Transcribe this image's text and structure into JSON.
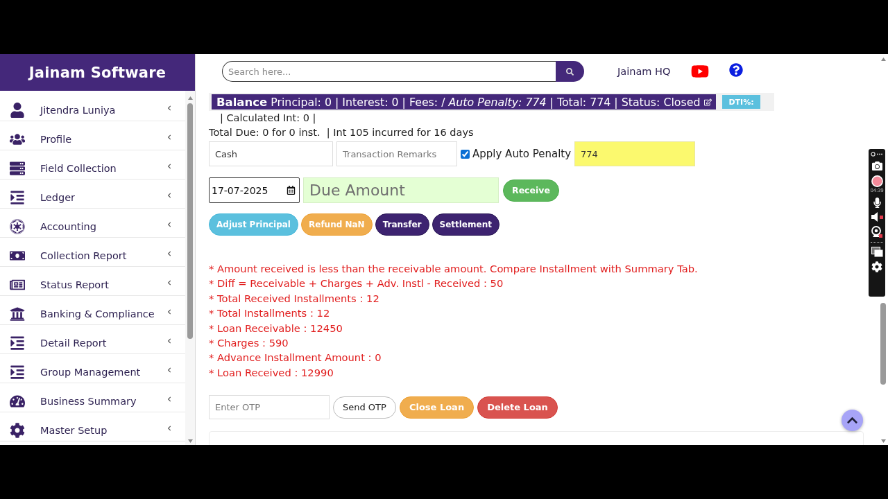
{
  "sidebar": {
    "title": "Jainam Software",
    "items": [
      {
        "label": "Jitendra Luniya"
      },
      {
        "label": "Profile"
      },
      {
        "label": "Field Collection"
      },
      {
        "label": "Ledger"
      },
      {
        "label": "Accounting"
      },
      {
        "label": "Collection Report"
      },
      {
        "label": "Status Report"
      },
      {
        "label": "Banking & Compliance"
      },
      {
        "label": "Detail Report"
      },
      {
        "label": "Group Management"
      },
      {
        "label": "Business Summary"
      },
      {
        "label": "Master Setup"
      }
    ]
  },
  "header": {
    "search": {
      "placeholder": "Search here..."
    },
    "branch": "Jainam HQ"
  },
  "balance": {
    "summary": "**Balance** Principal: 0 | Interest: 0 | Fees: / *Auto Penalty: 774* | Total: 774 | Status: Closed",
    "badge": "DTI%:",
    "calculated": "| Calculated Int: 0 |",
    "total_due": "Total Due: 0 for 0 inst.  | Int 105 incurred for 16 days"
  },
  "payment_form": {
    "mode": {
      "value": "Cash"
    },
    "remarks": {
      "placeholder": "Transaction Remarks"
    },
    "auto_penalty": {
      "label": "Apply Auto Penalty",
      "checked": true
    },
    "penalty_amount": {
      "value": "774"
    },
    "date": {
      "value": "17-07-2025"
    },
    "amount": {
      "placeholder": "Due Amount"
    },
    "receive_button": "Receive"
  },
  "actions": [
    {
      "label": "Adjust Principal",
      "kind": "info"
    },
    {
      "label": "Refund NaN",
      "kind": "warning"
    },
    {
      "label": "Transfer",
      "kind": "primary"
    },
    {
      "label": "Settlement",
      "kind": "primary"
    }
  ],
  "messages": [
    "* Amount received is less than the receivable amount. Compare Installment with Summary Tab.",
    "* Diff = Receivable + Charges + Adv. Instl - Received : 50",
    "* Total Received Installments : 12",
    "* Total Installments : 12",
    "* Loan Receivable : 12450",
    "* Charges : 590",
    "* Advance Installment Amount : 0",
    "* Loan Received : 12990"
  ],
  "otp": {
    "placeholder": "Enter OTP"
  },
  "loan_actions": [
    {
      "label": "Send OTP",
      "kind": "default"
    },
    {
      "label": "Close Loan",
      "kind": "warning"
    },
    {
      "label": "Delete Loan",
      "kind": "danger"
    }
  ],
  "recorder": {
    "timer": "04:39"
  }
}
